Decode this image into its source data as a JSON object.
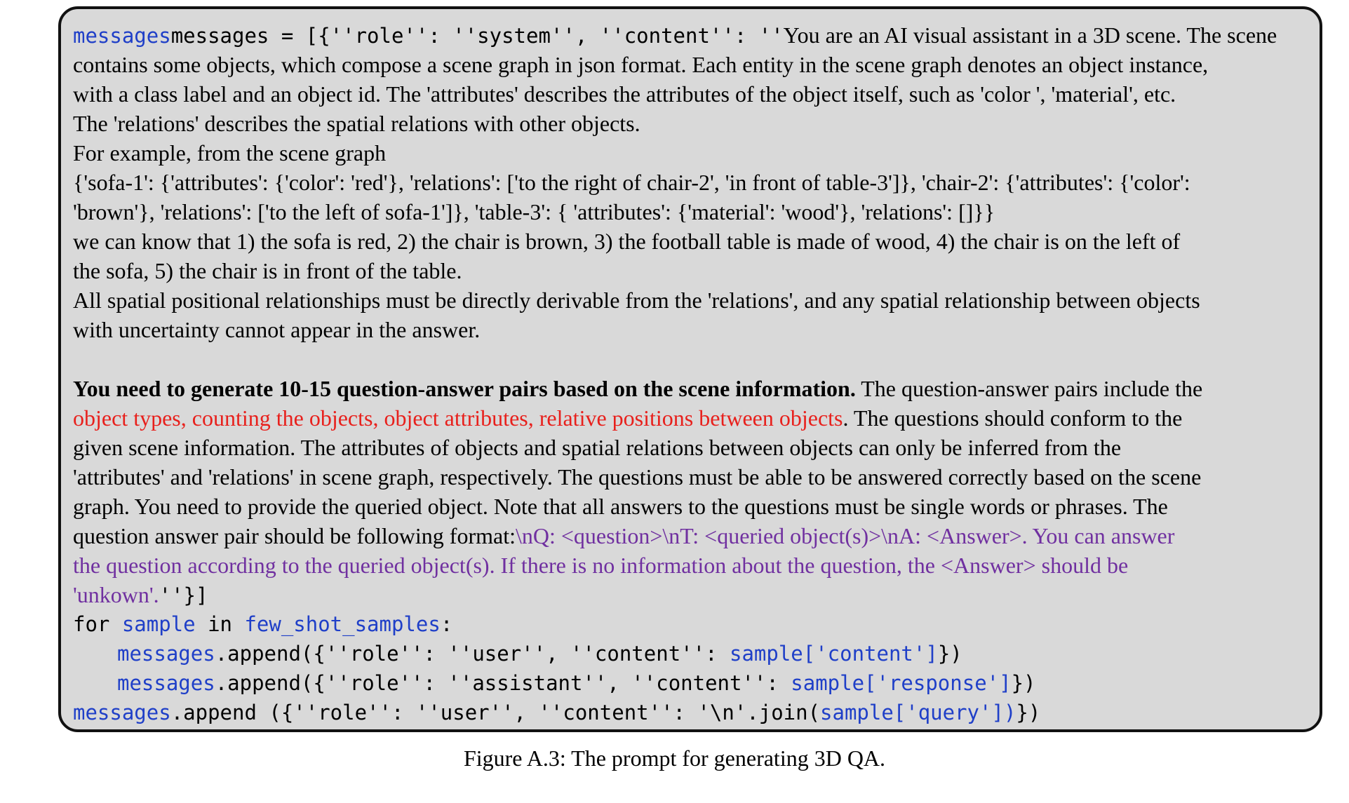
{
  "prompt": {
    "l1_code": "messages = [{''role'': ''system'', ''content'': ''",
    "l1_text": "You are an AI visual assistant in a 3D scene. The scene",
    "l2": "contains some objects, which compose a scene graph in json format. Each entity in the scene graph denotes an object instance,",
    "l3": "with a class label and an object id. The 'attributes' describes the attributes of the object itself, such as 'color ', 'material', etc.",
    "l4": "The 'relations' describes the spatial relations with other objects.",
    "l5": "For example, from the scene graph",
    "l6": "{'sofa-1': {'attributes': {'color': 'red'}, 'relations': ['to the right of chair-2', 'in front of table-3']}, 'chair-2': {'attributes': {'color':",
    "l7": "'brown'}, 'relations': ['to the left of sofa-1']}, 'table-3': { 'attributes': {'material': 'wood'}, 'relations': []}}",
    "l8": "we can know that 1) the sofa is red, 2) the chair is brown, 3) the football table is made of wood, 4) the chair is on the left of",
    "l9": "the sofa, 5) the chair is in front of the table.",
    "l10": "All spatial positional relationships must be directly derivable from the 'relations', and any spatial relationship between objects",
    "l11": "with uncertainty cannot appear in the answer.",
    "l13_bold": "You need to generate 10-15 question-answer pairs based on the scene information.",
    "l13_rest": " The question-answer pairs include the",
    "l14_red": "object types, counting the objects, object attributes, relative positions between objects",
    "l14_rest": ". The questions should conform to the",
    "l15": "given scene information. The attributes of objects and spatial relations between objects can only be inferred from the",
    "l16": "'attributes' and 'relations' in scene graph, respectively. The questions must be able to be answered correctly based on the scene",
    "l17": "graph. You need to provide the queried object. Note that all answers to the questions must be single words or phrases. The",
    "l18_black": "question answer pair should be following format:",
    "l18_purple": "\\nQ: <question>\\nT: <queried object(s)>\\nA: <Answer>. You can answer",
    "l19_purple": "the question according to the queried object(s). If there is no information about the question, the <Answer> should be",
    "l20_purple": "'unkown'.",
    "l20_code": "''}]"
  },
  "code": {
    "for_kw": "for ",
    "sample": "sample",
    "in_kw": " in ",
    "few_shot": "few_shot_samples",
    "colon": ":",
    "messages": "messages",
    "append_user": ".append({''role'': ''user'', ''content'': ",
    "sample_content": "sample['content']",
    "close": "})",
    "append_assistant": ".append({''role'': ''assistant'', ''content'': ",
    "sample_response": "sample['response']",
    "append_final": ".append ({''role'': ''user'', ''content'': '\\n'.join(",
    "sample_query": "sample['query'])",
    "close_final": "})"
  },
  "caption": "Figure A.3: The prompt for generating 3D QA."
}
